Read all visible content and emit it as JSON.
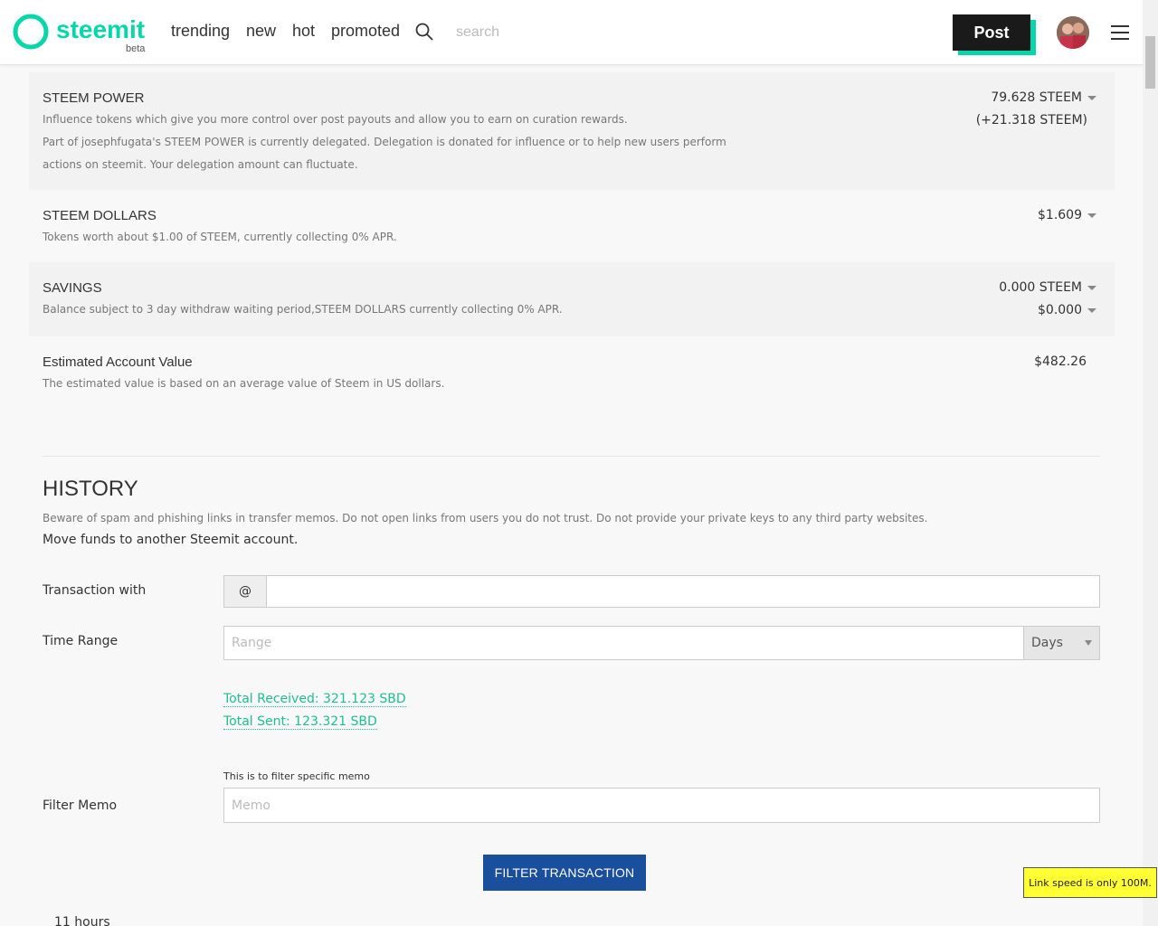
{
  "header": {
    "brand": "steemit",
    "brand_sub": "beta",
    "nav": [
      "trending",
      "new",
      "hot",
      "promoted"
    ],
    "search_placeholder": "search",
    "post_label": "Post",
    "brand_color": "#06d6a9"
  },
  "wallet": {
    "steem_power": {
      "title": "STEEM POWER",
      "desc1": "Influence tokens which give you more control over post payouts and allow you to earn on curation rewards.",
      "desc2": "Part of josephfugata's STEEM POWER is currently delegated. Delegation is donated for influence or to help new users perform",
      "desc3": "actions on steemit. Your delegation amount can fluctuate.",
      "value": "79.628 STEEM",
      "delegated": "(+21.318 STEEM)"
    },
    "steem_dollars": {
      "title": "STEEM DOLLARS",
      "desc": "Tokens worth about $1.00 of STEEM, currently collecting 0% APR.",
      "value": "$1.609"
    },
    "savings": {
      "title": "SAVINGS",
      "desc": "Balance subject to 3 day withdraw waiting period,STEEM DOLLARS currently collecting 0% APR.",
      "value_steem": "0.000 STEEM",
      "value_sbd": "$0.000"
    },
    "estimated": {
      "title": "Estimated Account Value",
      "desc": "The estimated value is based on an average value of Steem in US dollars.",
      "value": "$482.26"
    }
  },
  "history": {
    "title": "HISTORY",
    "warning": "Beware of spam and phishing links in transfer memos. Do not open links from users you do not trust. Do not provide your private keys to any third party websites.",
    "subtitle": "Move funds to another Steemit account.",
    "transaction_label": "Transaction with",
    "at_symbol": "@",
    "time_range_label": "Time Range",
    "range_placeholder": "Range",
    "range_unit": "Days",
    "total_received": "Total Received: 321.123 SBD",
    "total_sent": "Total Sent: 123.321 SBD",
    "filter_hint": "This is to filter specific memo",
    "filter_memo_label": "Filter Memo",
    "memo_placeholder": "Memo",
    "filter_button": "FILTER TRANSACTION",
    "partial_time": "11 hours"
  },
  "tooltip": "Link speed is only 100M."
}
